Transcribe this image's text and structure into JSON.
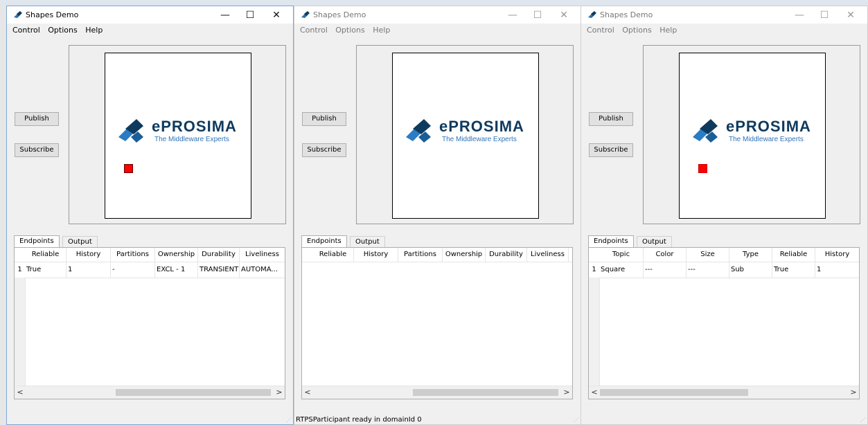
{
  "windows": [
    {
      "title": "Shapes Demo",
      "active": true,
      "menu": [
        "Control",
        "Options",
        "Help"
      ],
      "buttons": {
        "publish": "Publish",
        "subscribe": "Subscribe"
      },
      "logo": {
        "word": "ePROSIMA",
        "tagline": "The Middleware Experts"
      },
      "shape": {
        "visible": true,
        "color": "#ff0000",
        "kind": "published"
      },
      "tabs": [
        "Endpoints",
        "Output"
      ],
      "columns": [
        "Reliable",
        "History",
        "Partitions",
        "Ownership",
        "Durability",
        "Liveliness"
      ],
      "rows": [
        [
          "1",
          "True",
          "1",
          "-",
          "EXCL - 1",
          "TRANSIENT",
          "AUTOMA..."
        ]
      ],
      "status": ""
    },
    {
      "title": "Shapes Demo",
      "active": false,
      "menu": [
        "Control",
        "Options",
        "Help"
      ],
      "buttons": {
        "publish": "Publish",
        "subscribe": "Subscribe"
      },
      "logo": {
        "word": "ePROSIMA",
        "tagline": "The Middleware Experts"
      },
      "shape": {
        "visible": false
      },
      "tabs": [
        "Endpoints",
        "Output"
      ],
      "columns": [
        "Reliable",
        "History",
        "Partitions",
        "Ownership",
        "Durability",
        "Liveliness"
      ],
      "rows": [],
      "status": "RTPSParticipant ready in domainId 0"
    },
    {
      "title": "Shapes Demo",
      "active": false,
      "menu": [
        "Control",
        "Options",
        "Help"
      ],
      "buttons": {
        "publish": "Publish",
        "subscribe": "Subscribe"
      },
      "logo": {
        "word": "ePROSIMA",
        "tagline": "The Middleware Experts"
      },
      "shape": {
        "visible": true,
        "color": "#ff0000",
        "kind": "subscribed"
      },
      "tabs": [
        "Endpoints",
        "Output"
      ],
      "columns": [
        "Topic",
        "Color",
        "Size",
        "Type",
        "Reliable",
        "History"
      ],
      "rows": [
        [
          "1",
          "Square",
          "---",
          "---",
          "Sub",
          "True",
          "1"
        ]
      ],
      "status": ""
    }
  ],
  "window_controls": {
    "minimize": "—",
    "maximize": "☐",
    "close": "✕"
  },
  "scroll": {
    "left": "<",
    "right": ">"
  }
}
